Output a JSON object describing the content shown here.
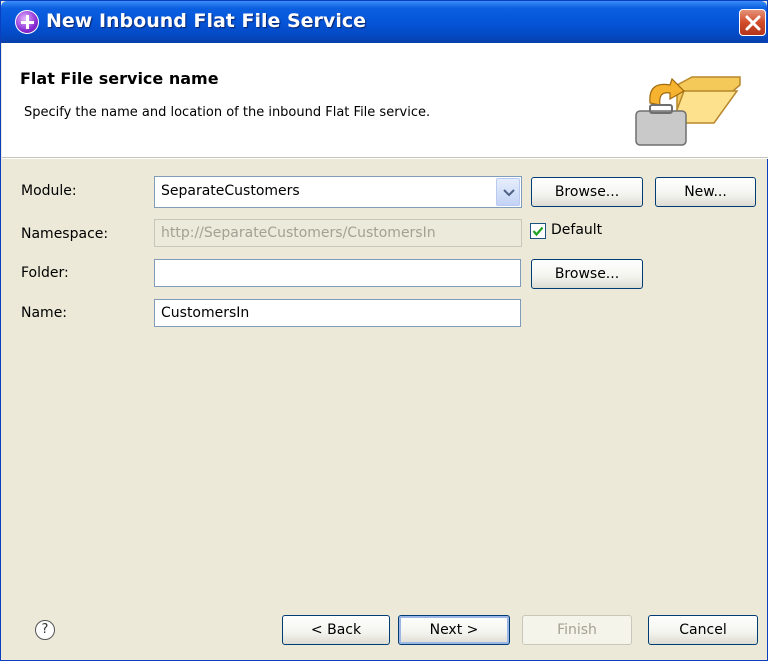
{
  "window": {
    "title": "New Inbound Flat File Service",
    "icon": "plus-icon"
  },
  "header": {
    "title": "Flat File service name",
    "description": "Specify the name and location of the inbound Flat File service.",
    "graphic": "wizard-folder-icon"
  },
  "form": {
    "module": {
      "label": "Module:",
      "value": "SeparateCustomers",
      "browse_label": "Browse...",
      "new_label": "New..."
    },
    "namespace": {
      "label": "Namespace:",
      "value": "http://SeparateCustomers/CustomersIn",
      "default_label": "Default",
      "default_checked": true
    },
    "folder": {
      "label": "Folder:",
      "value": "",
      "browse_label": "Browse..."
    },
    "name": {
      "label": "Name:",
      "value": "CustomersIn"
    }
  },
  "footer": {
    "help_label": "?",
    "back_label": "< Back",
    "next_label": "Next >",
    "finish_label": "Finish",
    "cancel_label": "Cancel"
  },
  "colors": {
    "titlebar": "#0553d6",
    "dialog_bg": "#ece9d8",
    "close": "#d24b2a",
    "checkmark": "#21a121"
  }
}
